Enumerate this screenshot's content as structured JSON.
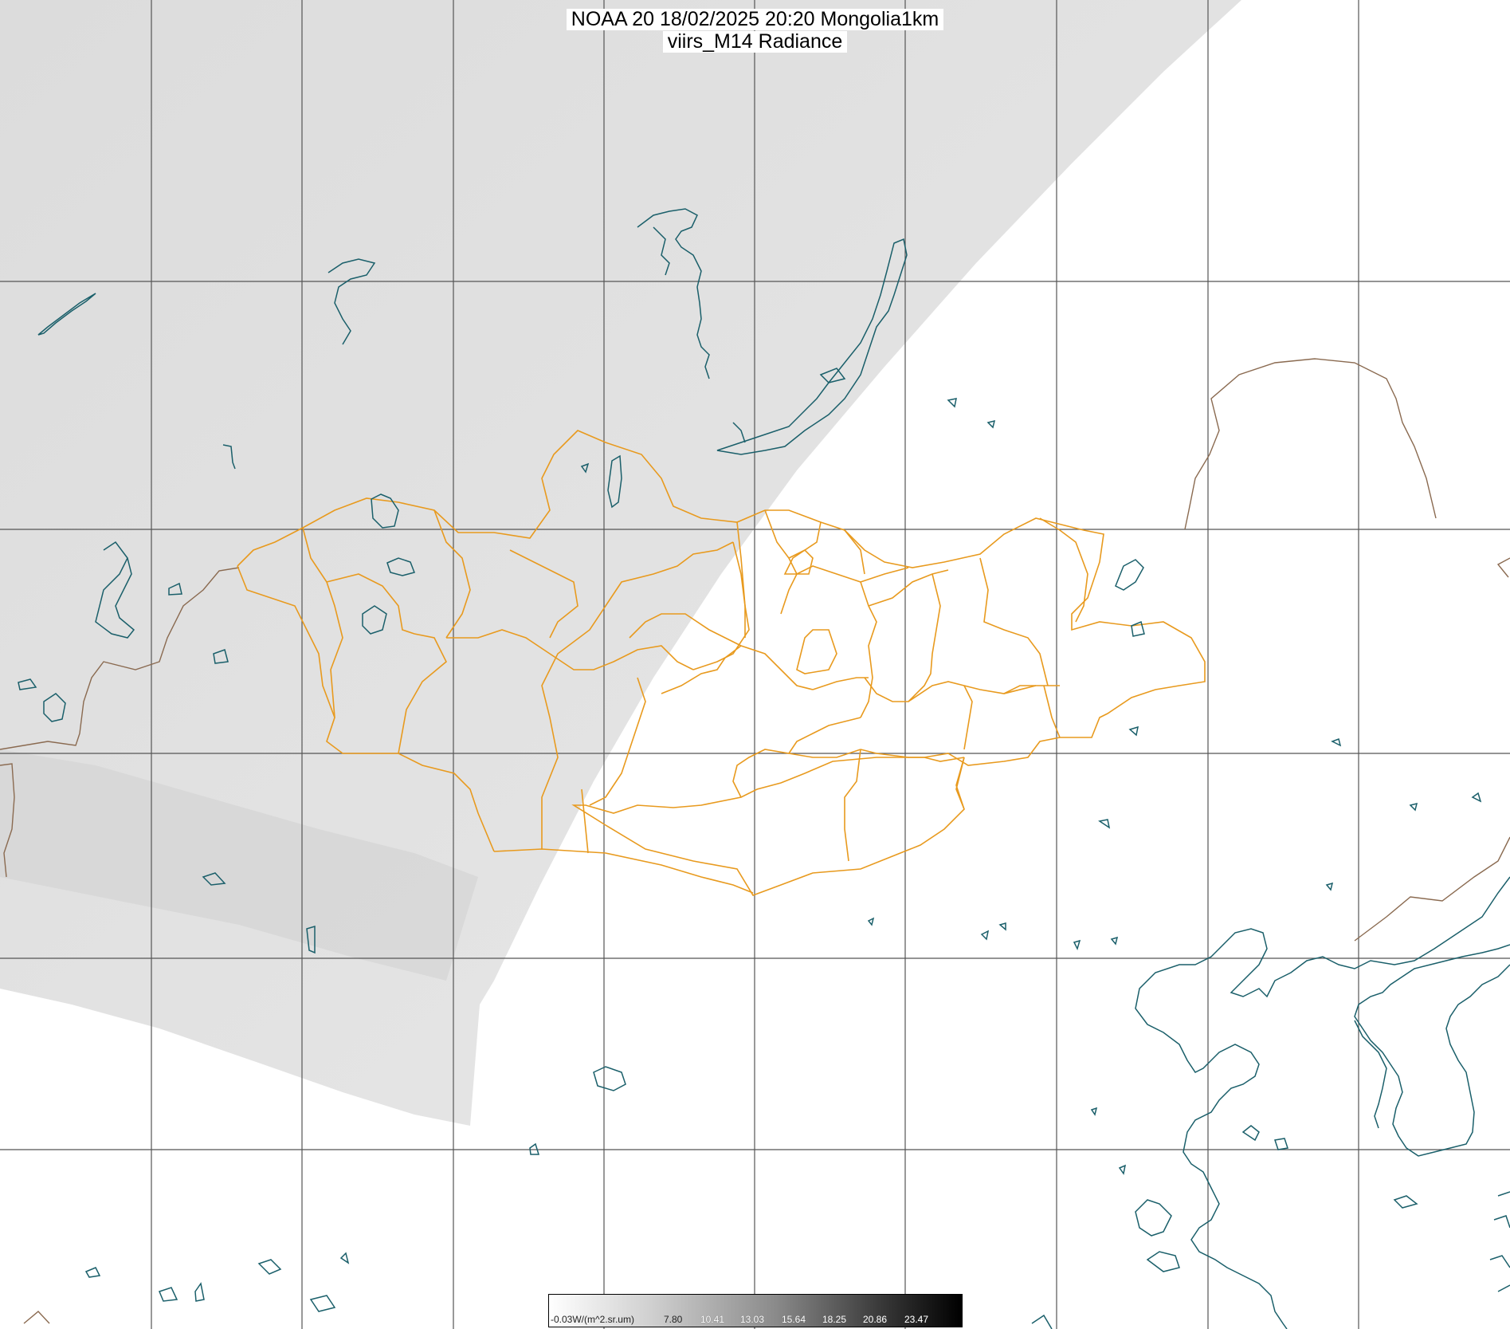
{
  "title": {
    "line1": "NOAA 20 18/02/2025 20:20 Mongolia1km",
    "line2": "viirs_M14 Radiance"
  },
  "legend": {
    "unit_label": "-0.03W/(m^2.sr.um)",
    "ticks": [
      "7.80",
      "10.41",
      "13.03",
      "15.64",
      "18.25",
      "20.86",
      "23.47"
    ],
    "colormap": "white-to-black grayscale"
  },
  "colors": {
    "swath": "#e6e6e6",
    "grid": "#555555",
    "water": "#1a5f6a",
    "mongolia_boundaries": "#e89a1e",
    "country_borders": "#8a6a50",
    "background": "#ffffff"
  }
}
